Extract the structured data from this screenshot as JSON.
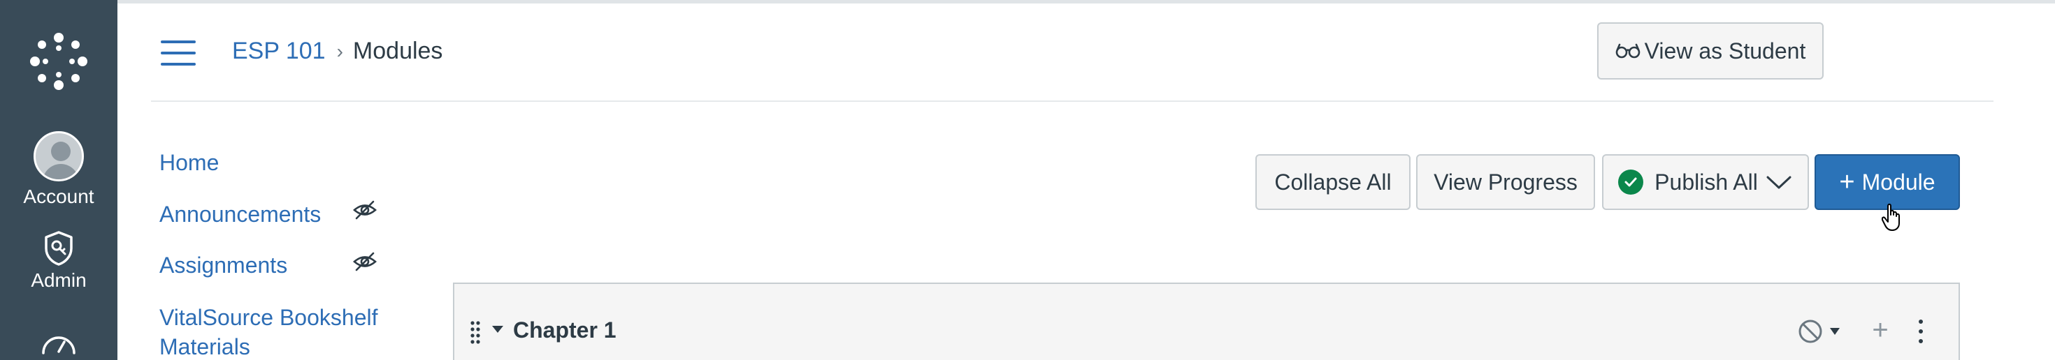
{
  "global_nav": {
    "account_label": "Account",
    "admin_label": "Admin"
  },
  "header": {
    "breadcrumb_course": "ESP 101",
    "breadcrumb_separator": "›",
    "breadcrumb_current": "Modules",
    "view_as_student_label": "View as Student"
  },
  "course_nav": {
    "items": [
      {
        "label": "Home"
      },
      {
        "label": "Announcements"
      },
      {
        "label": "Assignments"
      },
      {
        "label": "VitalSource Bookshelf Materials"
      }
    ]
  },
  "toolbar": {
    "collapse_all_label": "Collapse All",
    "view_progress_label": "View Progress",
    "publish_all_label": "Publish All",
    "add_module_label": "Module",
    "add_module_icon": "+"
  },
  "modules": [
    {
      "title": "Chapter 1"
    }
  ],
  "colors": {
    "global_nav_bg": "#394b58",
    "link": "#2d6db5",
    "primary_button": "#2b73b8",
    "publish_ok": "#0b874b"
  }
}
